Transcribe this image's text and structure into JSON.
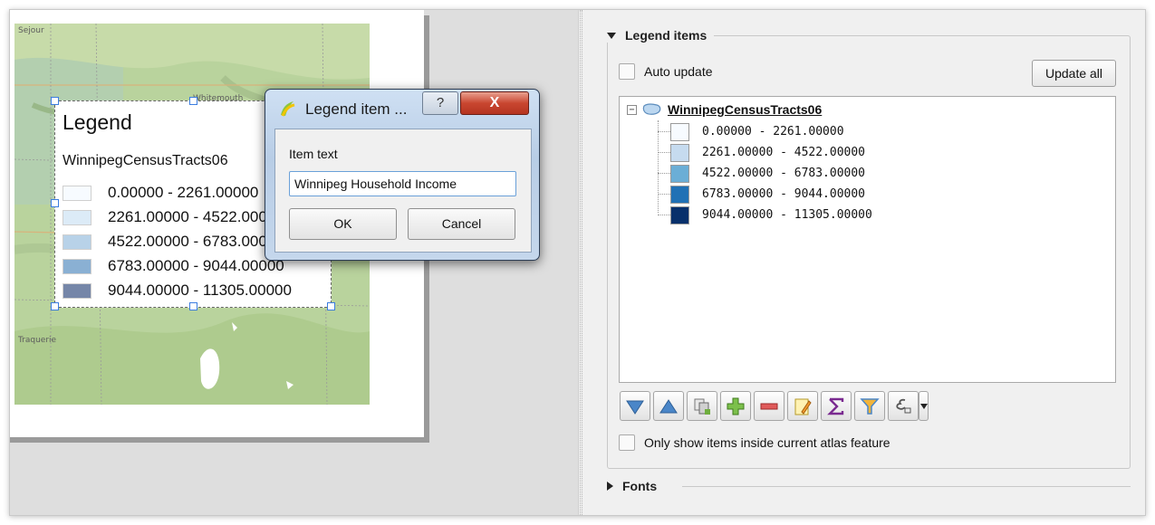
{
  "map": {
    "place_labels": [
      "Sejour",
      "Whitemouth",
      "Traquerie"
    ]
  },
  "legend_item": {
    "title": "Legend",
    "layer_name": "WinnipegCensusTracts06",
    "classes": [
      {
        "label": "0.00000 - 2261.00000",
        "color": "#f7fbff"
      },
      {
        "label": "2261.00000 - 4522.00000",
        "color": "#dcebf7"
      },
      {
        "label": "4522.00000 - 6783.00000",
        "color": "#b8d2e8"
      },
      {
        "label": "6783.00000 - 9044.00000",
        "color": "#8ab0d3"
      },
      {
        "label": "9044.00000 - 11305.00000",
        "color": "#7586a8"
      }
    ]
  },
  "dialog": {
    "title": "Legend item ...",
    "help_label": "?",
    "close_label": "X",
    "item_text_label": "Item text",
    "item_text_value": "Winnipeg Household Income",
    "ok_label": "OK",
    "cancel_label": "Cancel"
  },
  "panel": {
    "legend_items_header": "Legend items",
    "auto_update_label": "Auto update",
    "auto_update_checked": false,
    "update_all_label": "Update all",
    "tree": {
      "layer_name": "WinnipegCensusTracts06",
      "items": [
        {
          "label": "0.00000 - 2261.00000",
          "color": "#f7fbff"
        },
        {
          "label": "2261.00000 - 4522.00000",
          "color": "#c6dbef"
        },
        {
          "label": "4522.00000 - 6783.00000",
          "color": "#6baed6"
        },
        {
          "label": "6783.00000 - 9044.00000",
          "color": "#2171b5"
        },
        {
          "label": "9044.00000 - 11305.00000",
          "color": "#08306b"
        }
      ]
    },
    "toolbar_buttons": [
      "move-down-icon",
      "move-up-icon",
      "copy-layers-icon",
      "add-item-icon",
      "remove-item-icon",
      "edit-item-icon",
      "sum-count-icon",
      "filter-icon",
      "expression-icon"
    ],
    "only_show_inside_atlas_label": "Only show items inside current atlas feature",
    "only_show_inside_atlas_checked": false,
    "fonts_header": "Fonts"
  }
}
